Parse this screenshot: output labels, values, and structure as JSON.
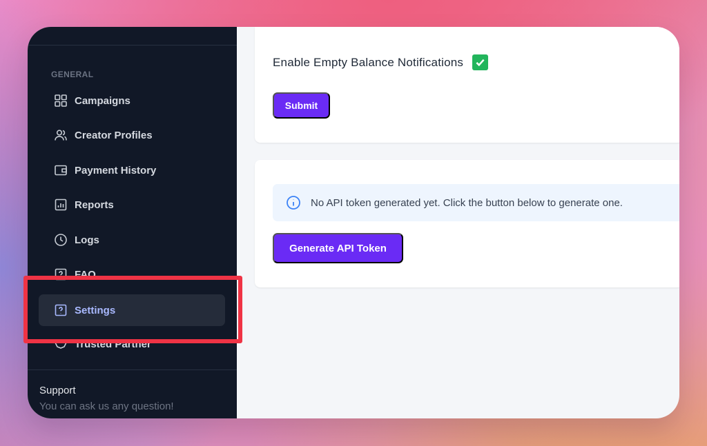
{
  "sidebar": {
    "section_label": "GENERAL",
    "items": [
      {
        "label": "Campaigns",
        "icon": "grid-icon"
      },
      {
        "label": "Creator Profiles",
        "icon": "users-icon"
      },
      {
        "label": "Payment History",
        "icon": "wallet-icon"
      },
      {
        "label": "Reports",
        "icon": "chart-icon"
      },
      {
        "label": "Logs",
        "icon": "clock-icon"
      },
      {
        "label": "FAQ",
        "icon": "question-icon"
      },
      {
        "label": "Settings",
        "icon": "question-icon",
        "active": true
      },
      {
        "label": "Trusted Partner",
        "icon": "handshake-icon"
      }
    ],
    "support": {
      "title": "Support",
      "subtitle": "You can ask us any question!"
    }
  },
  "notifications": {
    "label": "Enable Empty Balance Notifications",
    "checked": true,
    "submit_label": "Submit"
  },
  "api": {
    "info_text": "No API token generated yet. Click the button below to generate one.",
    "generate_label": "Generate API Token"
  },
  "colors": {
    "accent": "#6a2bf5",
    "highlight": "#ef3345",
    "sidebar_bg": "#111827",
    "check_green": "#22b55c"
  }
}
